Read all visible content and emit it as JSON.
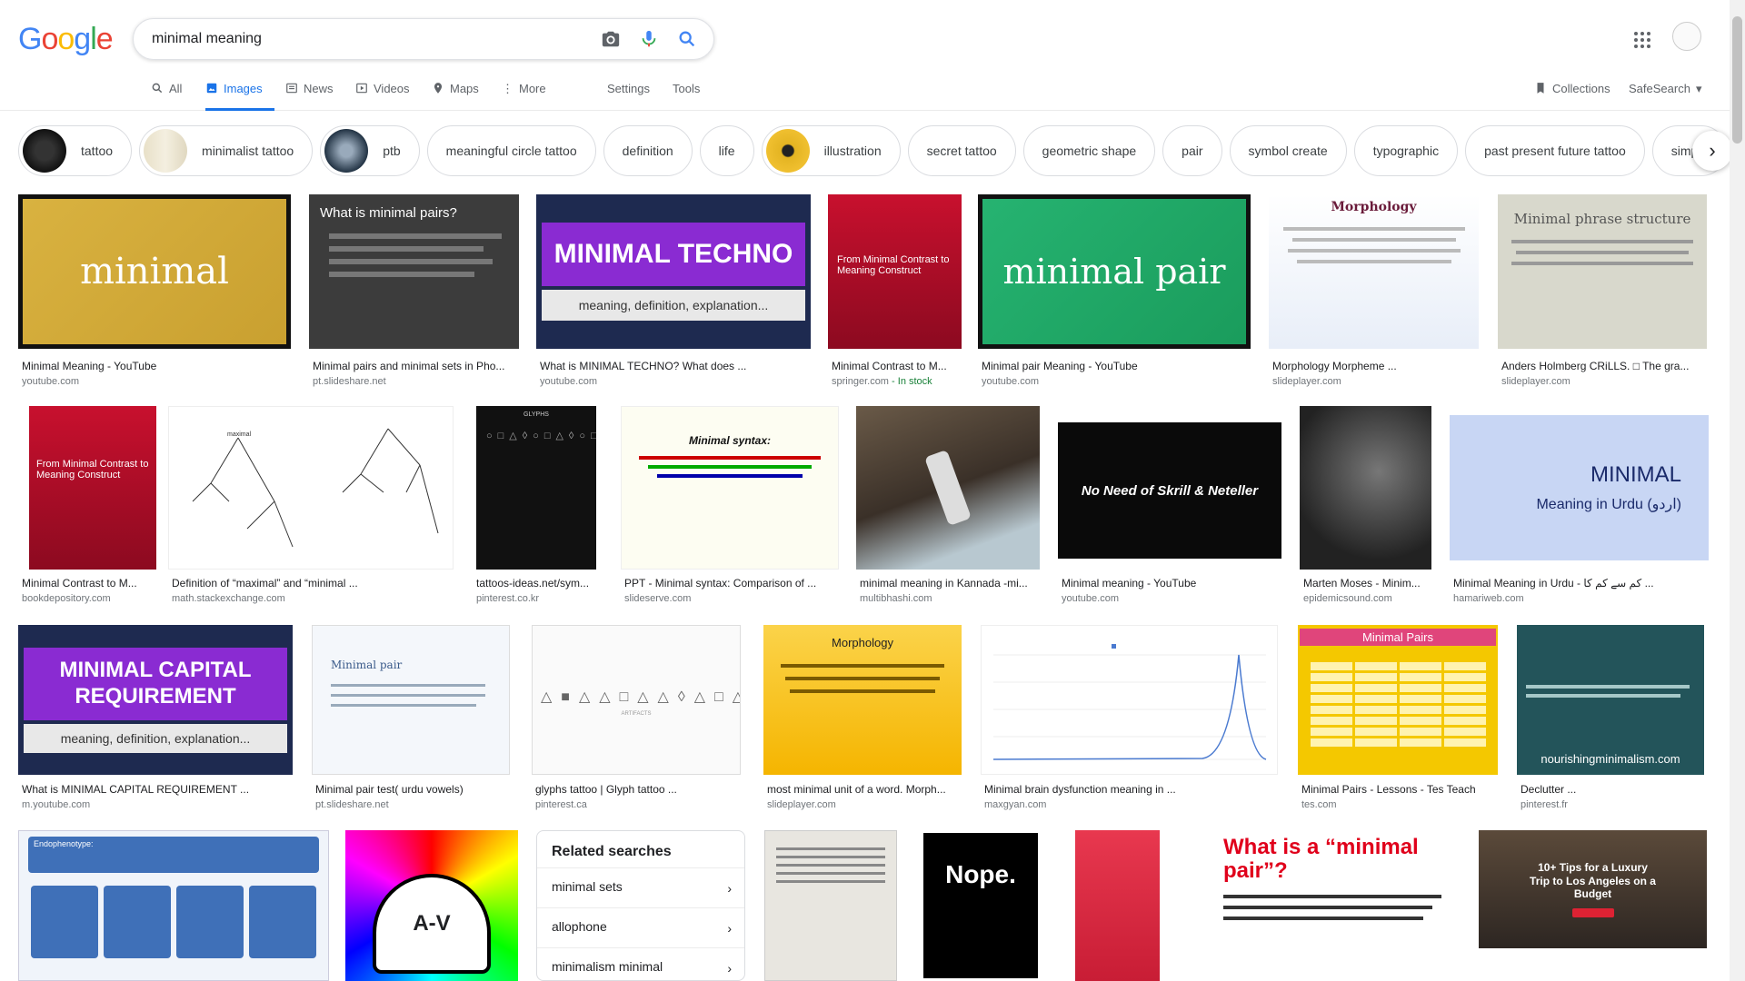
{
  "logo": {
    "letters": [
      "G",
      "o",
      "o",
      "g",
      "l",
      "e"
    ],
    "colors": [
      "#4285f4",
      "#ea4335",
      "#fbbc05",
      "#4285f4",
      "#34a853",
      "#ea4335"
    ]
  },
  "search": {
    "query": "minimal meaning"
  },
  "tabs": [
    {
      "label": "All",
      "icon": "search-icon"
    },
    {
      "label": "Images",
      "icon": "image-icon",
      "active": true
    },
    {
      "label": "News",
      "icon": "news-icon"
    },
    {
      "label": "Videos",
      "icon": "video-icon"
    },
    {
      "label": "Maps",
      "icon": "map-icon"
    },
    {
      "label": "More",
      "icon": "more-vertical-icon"
    },
    {
      "label": "Settings"
    },
    {
      "label": "Tools"
    }
  ],
  "right_tabs": {
    "collections": "Collections",
    "safesearch": "SafeSearch"
  },
  "chips": [
    {
      "label": "tattoo",
      "thumb": true
    },
    {
      "label": "minimalist tattoo",
      "thumb": true
    },
    {
      "label": "ptb",
      "thumb": true
    },
    {
      "label": "meaningful circle tattoo"
    },
    {
      "label": "definition"
    },
    {
      "label": "life"
    },
    {
      "label": "illustration",
      "thumb": true
    },
    {
      "label": "secret tattoo"
    },
    {
      "label": "geometric shape"
    },
    {
      "label": "pair"
    },
    {
      "label": "symbol create"
    },
    {
      "label": "typographic"
    },
    {
      "label": "past present future tattoo"
    },
    {
      "label": "simple"
    }
  ],
  "results": [
    {
      "title": "Minimal Meaning - YouTube",
      "source": "youtube.com",
      "thumb_text": "minimal"
    },
    {
      "title": "Minimal pairs and minimal sets in Pho...",
      "source": "pt.slideshare.net",
      "thumb_text": "What is minimal pairs?"
    },
    {
      "title": "What is MINIMAL TECHNO? What does ...",
      "source": "youtube.com",
      "thumb_text": "MINIMAL TECHNO",
      "thumb_sub": "meaning, definition, explanation..."
    },
    {
      "title": "Minimal Contrast to M...",
      "source": "springer.com",
      "source_extra": " - In stock",
      "thumb_text": "From Minimal Contrast to Meaning Construct"
    },
    {
      "title": "Minimal pair Meaning - YouTube",
      "source": "youtube.com",
      "thumb_text": "minimal pair"
    },
    {
      "title": "Morphology Morpheme ...",
      "source": "slideplayer.com",
      "thumb_text": "Morphology"
    },
    {
      "title": "Anders Holmberg CRiLLS. □ The gra...",
      "source": "slideplayer.com",
      "thumb_text": "Minimal phrase structure"
    },
    {
      "title": "Minimal Contrast to M...",
      "source": "bookdepository.com",
      "thumb_text": "From Minimal Contrast to Meaning Construct"
    },
    {
      "title": "Definition of “maximal” and “minimal ...",
      "source": "math.stackexchange.com",
      "thumb_text": "maximal"
    },
    {
      "title": "tattoos-ideas.net/sym...",
      "source": "pinterest.co.kr",
      "thumb_text": "GLYPHS"
    },
    {
      "title": "PPT - Minimal syntax: Comparison of ...",
      "source": "slideserve.com",
      "thumb_text": "Minimal syntax:"
    },
    {
      "title": "minimal meaning in Kannada -mi...",
      "source": "multibhashi.com",
      "thumb_text": ""
    },
    {
      "title": "Minimal meaning - YouTube",
      "source": "youtube.com",
      "thumb_text": "No Need of Skrill & Neteller"
    },
    {
      "title": "Marten Moses - Minim...",
      "source": "epidemicsound.com",
      "thumb_text": ""
    },
    {
      "title": "Minimal Meaning in Urdu - کم سے کم کا ...",
      "source": "hamariweb.com",
      "thumb_text": "MINIMAL",
      "thumb_sub": "Meaning in Urdu (اردو)"
    },
    {
      "title": "What is MINIMAL CAPITAL REQUIREMENT ...",
      "source": "m.youtube.com",
      "thumb_text": "MINIMAL CAPITAL REQUIREMENT",
      "thumb_sub": "meaning, definition, explanation..."
    },
    {
      "title": "Minimal pair test( urdu vowels)",
      "source": "pt.slideshare.net",
      "thumb_text": "Minimal pair"
    },
    {
      "title": "glyphs tattoo | Glyph tattoo ...",
      "source": "pinterest.ca",
      "thumb_text": "ARTIFACTS"
    },
    {
      "title": "most minimal unit of a word. Morph...",
      "source": "slideplayer.com",
      "thumb_text": "Morphology"
    },
    {
      "title": "Minimal brain dysfunction meaning in ...",
      "source": "maxgyan.com",
      "thumb_text": ""
    },
    {
      "title": "Minimal Pairs - Lessons - Tes Teach",
      "source": "tes.com",
      "thumb_text": "Minimal Pairs"
    },
    {
      "title": "Declutter ...",
      "source": "pinterest.fr",
      "thumb_text": "nourishingminimalism.com"
    }
  ],
  "bottom_thumbs": [
    {
      "thumb_text": "Endophenotype:"
    },
    {
      "thumb_text": "A-V"
    },
    {
      "thumb_text": ""
    },
    {
      "thumb_text": "Nope."
    },
    {
      "thumb_text": ""
    },
    {
      "thumb_text": "What is a “minimal pair”?"
    },
    {
      "thumb_text": "10+ Tips for a Luxury Trip to Los Angeles on a Budget"
    }
  ],
  "related": {
    "title": "Related searches",
    "items": [
      "minimal sets",
      "allophone",
      "minimalism minimal"
    ]
  }
}
